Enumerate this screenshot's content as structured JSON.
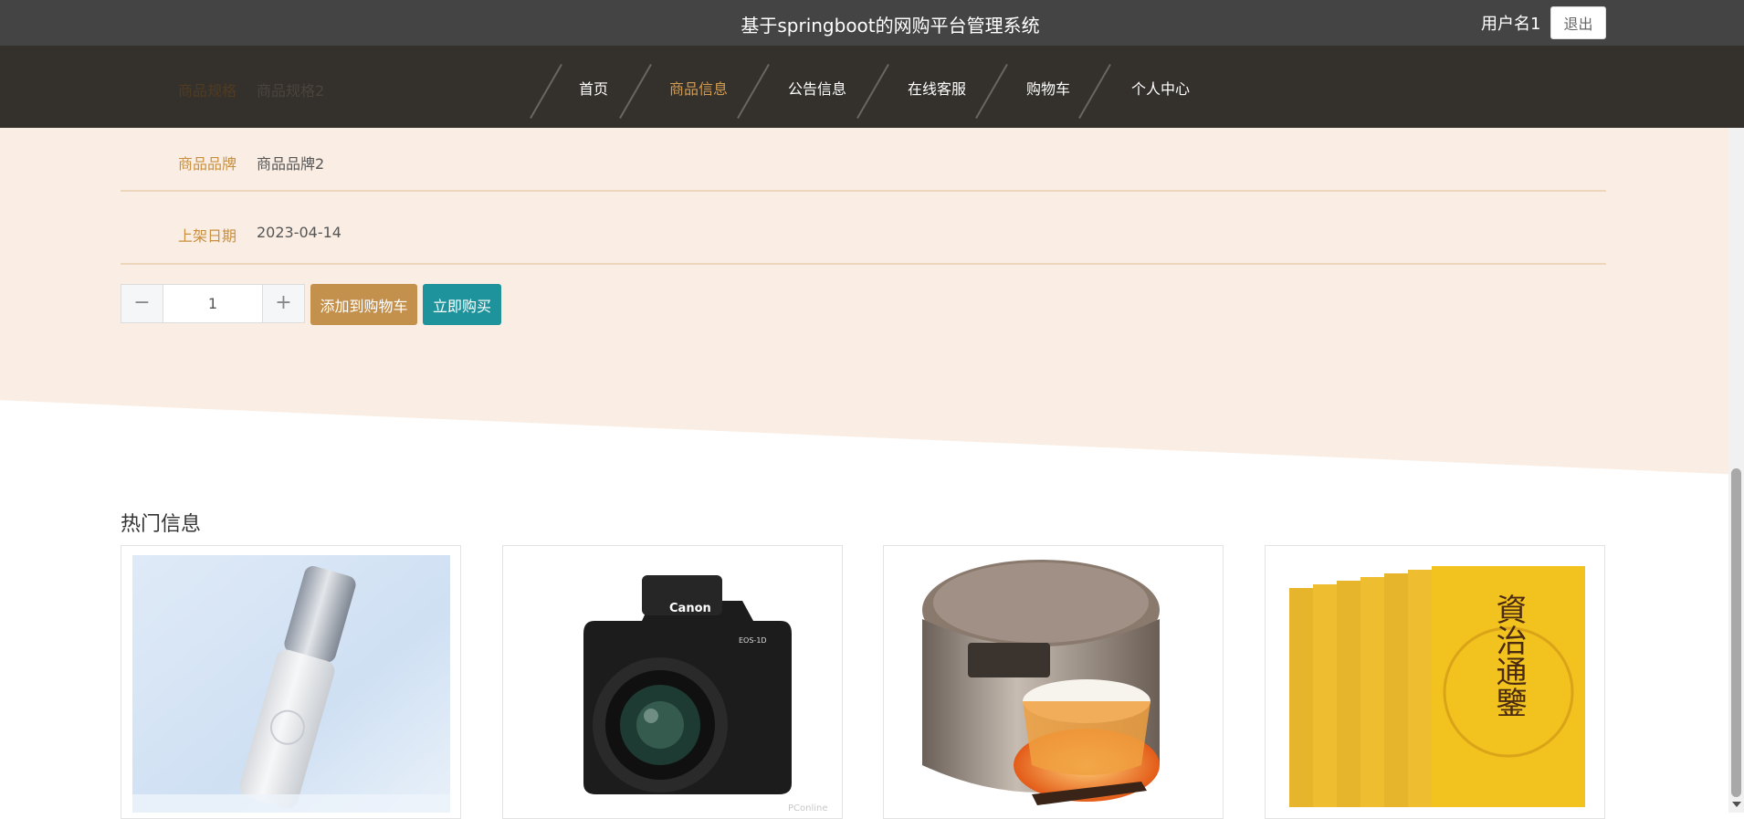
{
  "header": {
    "title": "基于springboot的网购平台管理系统",
    "username": "用户名1",
    "logout_label": "退出"
  },
  "nav": {
    "hidden_row_label": "商品规格",
    "hidden_row_value": "商品规格2",
    "items": [
      {
        "label": "首页"
      },
      {
        "label": "商品信息",
        "active": true
      },
      {
        "label": "公告信息"
      },
      {
        "label": "在线客服"
      },
      {
        "label": "购物车"
      },
      {
        "label": "个人中心"
      }
    ]
  },
  "detail": {
    "rows": [
      {
        "label": "商品品牌",
        "value": "商品品牌2"
      },
      {
        "label": "上架日期",
        "value": "2023-04-14"
      }
    ],
    "quantity": {
      "minus": "−",
      "value": "1",
      "plus": "+"
    },
    "add_to_cart_label": "添加到购物车",
    "buy_now_label": "立即购买"
  },
  "hot": {
    "title": "热门信息",
    "cards": [
      {
        "image": "serum-bottle-image"
      },
      {
        "image": "camera-image",
        "camera_brand": "Canon",
        "camera_model": "EOS-1D",
        "watermark": "PConline"
      },
      {
        "image": "rice-cooker-image"
      },
      {
        "image": "books-image",
        "book_title": "資治通鑒"
      }
    ]
  },
  "colors": {
    "topbar": "#444444",
    "navbar": "#34312d",
    "nav_active": "#d19b51",
    "beige": "#faeee4",
    "label": "#c98f3e",
    "cart_button": "#c4914d",
    "buy_button": "#1f939c"
  }
}
